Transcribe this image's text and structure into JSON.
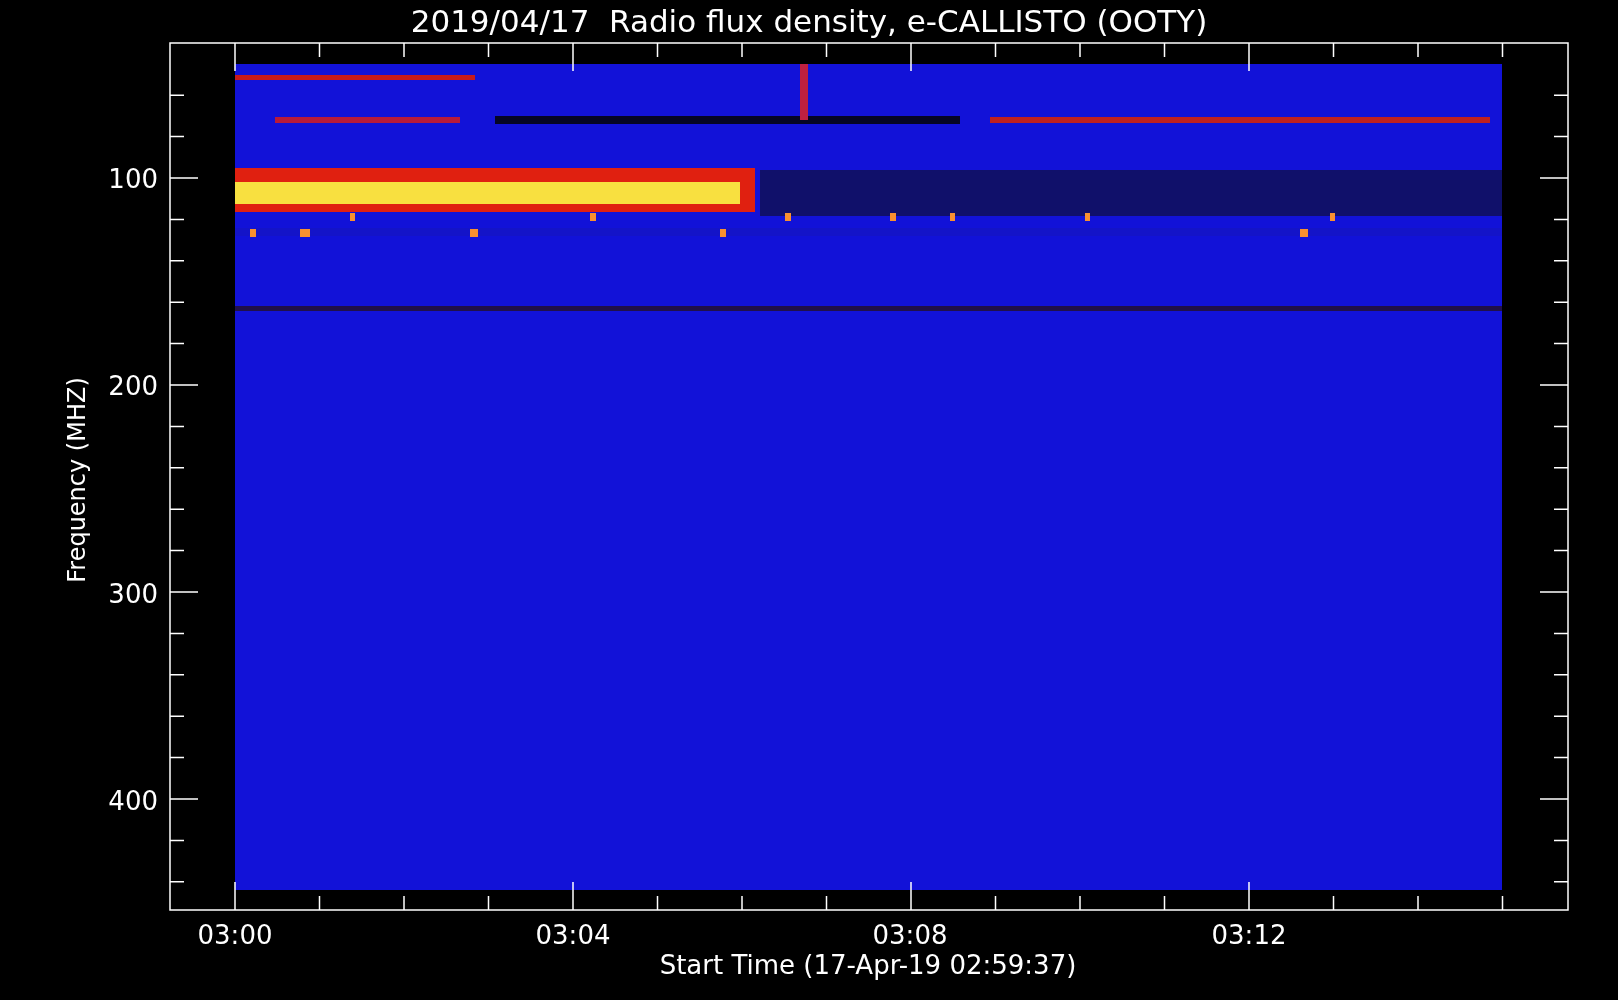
{
  "title": "2019/04/17  Radio flux density, e-CALLISTO (OOTY)",
  "y_axis": {
    "label": "Frequency (MHZ)",
    "tick_labels": [
      "100",
      "200",
      "300",
      "400"
    ]
  },
  "x_axis": {
    "label": "Start Time (17-Apr-19 02:59:37)",
    "tick_labels": [
      "03:00",
      "03:04",
      "03:08",
      "03:12"
    ]
  }
}
